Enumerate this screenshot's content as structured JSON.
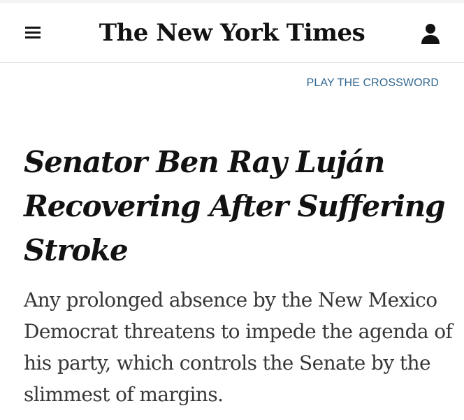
{
  "masthead": {
    "logo_text": "The New York Times",
    "menu_icon": "hamburger-menu-icon",
    "account_icon": "user-account-icon"
  },
  "header_link": {
    "label": "PLAY THE CROSSWORD"
  },
  "article": {
    "headline": "Senator Ben Ray Luján Recovering After Suffering Stroke",
    "summary": "Any prolonged absence by the New Mexico Democrat threatens to impede the agenda of his party, which controls the Senate by the slimmest of margins."
  },
  "colors": {
    "text": "#121212",
    "summary_text": "#363636",
    "link": "#326891",
    "divider": "#dcdcdc"
  }
}
